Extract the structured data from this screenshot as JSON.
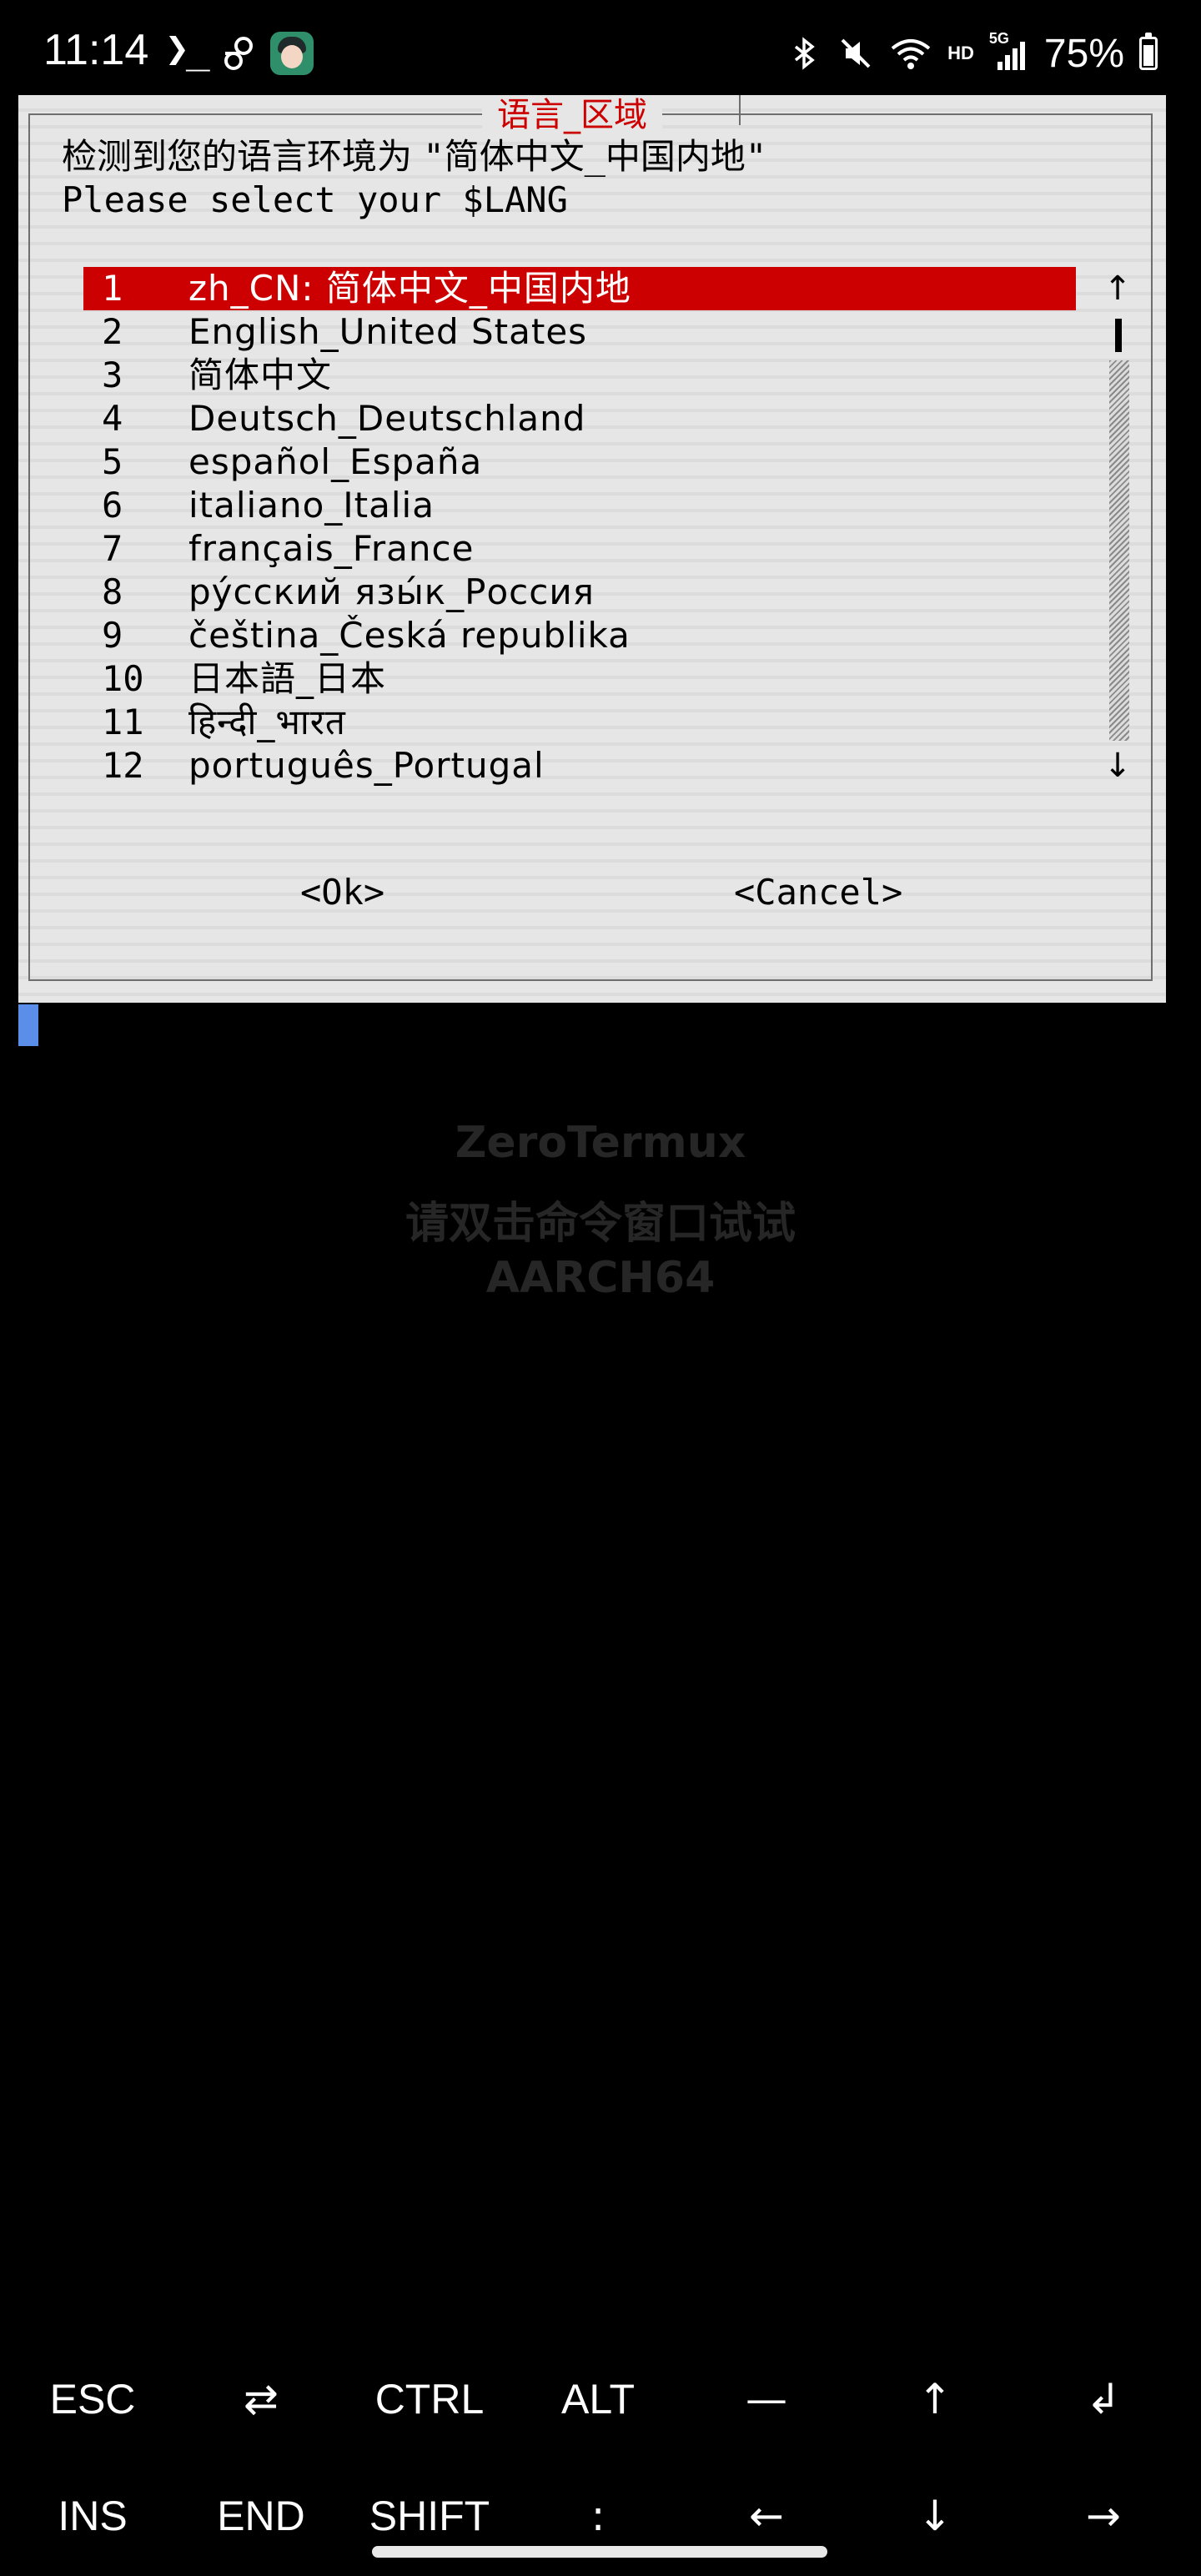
{
  "status_bar": {
    "time": "11:14",
    "prompt_glyph": "❯_",
    "network_label": "HD",
    "signal_label": "5G",
    "battery_percent": "75%",
    "battery_level": 0.75,
    "icons": [
      "terminal-icon",
      "link-icon",
      "avatar-icon",
      "bluetooth-icon",
      "mute-icon",
      "wifi-icon",
      "signal-icon",
      "battery-icon"
    ]
  },
  "dialog": {
    "title": "语言_区域",
    "message_prefix": "检测到您的语言环境为 ",
    "message_locale": "\"简体中文_中国内地\"",
    "prompt": "Please select your $LANG",
    "items": [
      {
        "num": "1",
        "label": "zh_CN: 简体中文_中国内地"
      },
      {
        "num": "2",
        "label": "English_United States"
      },
      {
        "num": "3",
        "label": "简体中文"
      },
      {
        "num": "4",
        "label": "Deutsch_Deutschland"
      },
      {
        "num": "5",
        "label": "español_España"
      },
      {
        "num": "6",
        "label": "italiano_Italia"
      },
      {
        "num": "7",
        "label": "français_France"
      },
      {
        "num": "8",
        "label": "ру́сский язы́к_Россия"
      },
      {
        "num": "9",
        "label": "čeština_Česká republika"
      },
      {
        "num": "10",
        "label": "日本語_日本"
      },
      {
        "num": "11",
        "label": "हिन्दी_भारत"
      },
      {
        "num": "12",
        "label": "português_Portugal"
      }
    ],
    "selected_index": 0,
    "scroll_up": "↑",
    "scroll_down": "↓",
    "ok_label": "<Ok>",
    "cancel_label": "<Cancel>",
    "colors": {
      "selected_bg": "#cc0000",
      "title": "#cc0000",
      "cursor": "#5b8ee8"
    }
  },
  "watermark": {
    "line1": "ZeroTermux",
    "line2": "请双击命令窗口试试",
    "line3": "AARCH64"
  },
  "extra_keys": {
    "row1": [
      "ESC",
      "⇄",
      "CTRL",
      "ALT",
      "—",
      "↑",
      "↲"
    ],
    "row2": [
      "INS",
      "END",
      "SHIFT",
      ":",
      "←",
      "↓",
      "→"
    ]
  }
}
